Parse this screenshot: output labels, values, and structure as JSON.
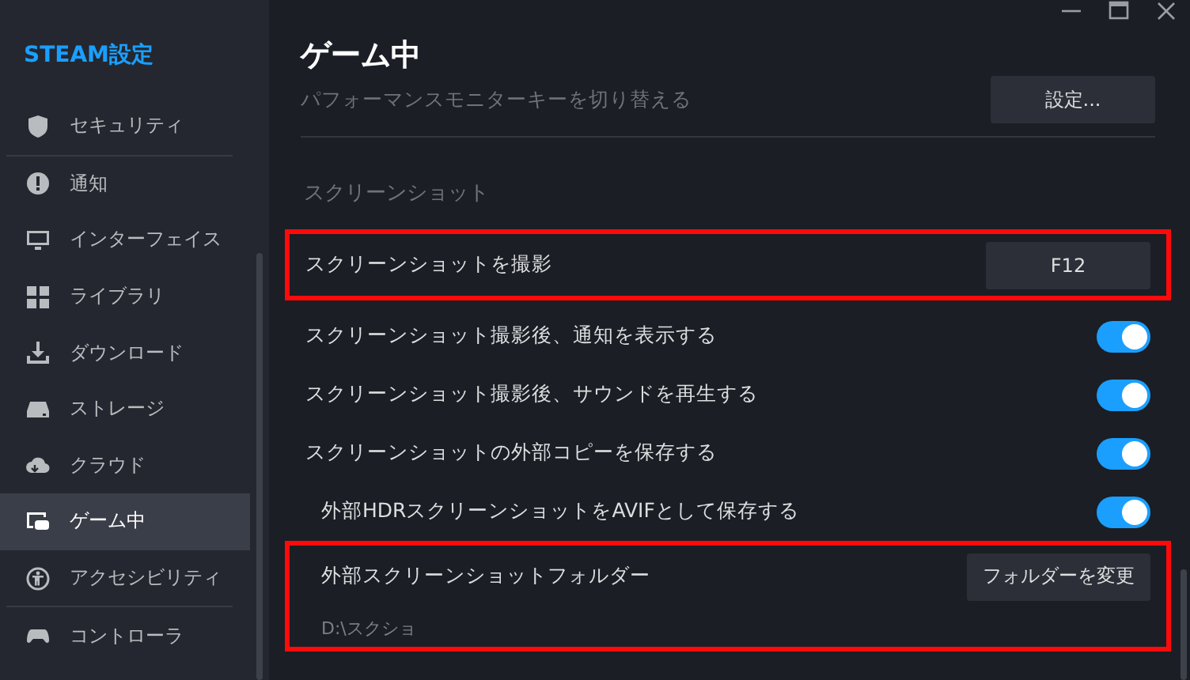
{
  "sidebar": {
    "title": "STEAM設定",
    "items": [
      {
        "label": "セキュリティ",
        "selected": false,
        "divider_after": true
      },
      {
        "label": "通知",
        "selected": false
      },
      {
        "label": "インターフェイス",
        "selected": false
      },
      {
        "label": "ライブラリ",
        "selected": false
      },
      {
        "label": "ダウンロード",
        "selected": false
      },
      {
        "label": "ストレージ",
        "selected": false
      },
      {
        "label": "クラウド",
        "selected": false
      },
      {
        "label": "ゲーム中",
        "selected": true
      },
      {
        "label": "アクセシビリティ",
        "selected": false,
        "divider_after": true
      },
      {
        "label": "コントローラ",
        "selected": false
      }
    ]
  },
  "page": {
    "title": "ゲーム中",
    "partial_row": {
      "label": "パフォーマンスモニターキーを切り替える",
      "button": "設定..."
    },
    "section": "スクリーンショット",
    "rows": [
      {
        "kind": "button",
        "label": "スクリーンショットを撮影",
        "button": "F12",
        "highlighted": true
      },
      {
        "kind": "toggle",
        "label": "スクリーンショット撮影後、通知を表示する",
        "on": true
      },
      {
        "kind": "toggle",
        "label": "スクリーンショット撮影後、サウンドを再生する",
        "on": true
      },
      {
        "kind": "toggle",
        "label": "スクリーンショットの外部コピーを保存する",
        "on": true,
        "children": [
          {
            "kind": "toggle",
            "label": "外部HDRスクリーンショットをAVIFとして保存する",
            "on": true
          }
        ]
      },
      {
        "kind": "folder",
        "label": "外部スクリーンショットフォルダー",
        "button": "フォルダーを変更",
        "path": "D:\\スクショ",
        "highlighted": true
      }
    ]
  }
}
